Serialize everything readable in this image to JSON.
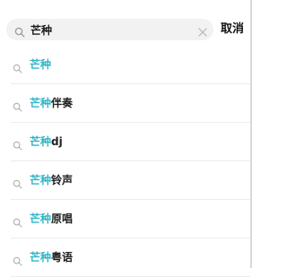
{
  "search": {
    "query": "芒种",
    "cancel_label": "取消"
  },
  "colors": {
    "highlight": "#31b6c7",
    "text": "#1f1f1f",
    "search_bg": "#f2f2f2"
  },
  "icons": {
    "search": "search-icon",
    "clear": "close-icon"
  },
  "suggestions": [
    {
      "match": "芒种",
      "rest": ""
    },
    {
      "match": "芒种",
      "rest": "伴奏"
    },
    {
      "match": "芒种",
      "rest": "dj"
    },
    {
      "match": "芒种",
      "rest": "铃声"
    },
    {
      "match": "芒种",
      "rest": "原唱"
    },
    {
      "match": "芒种",
      "rest": "粤语"
    }
  ]
}
